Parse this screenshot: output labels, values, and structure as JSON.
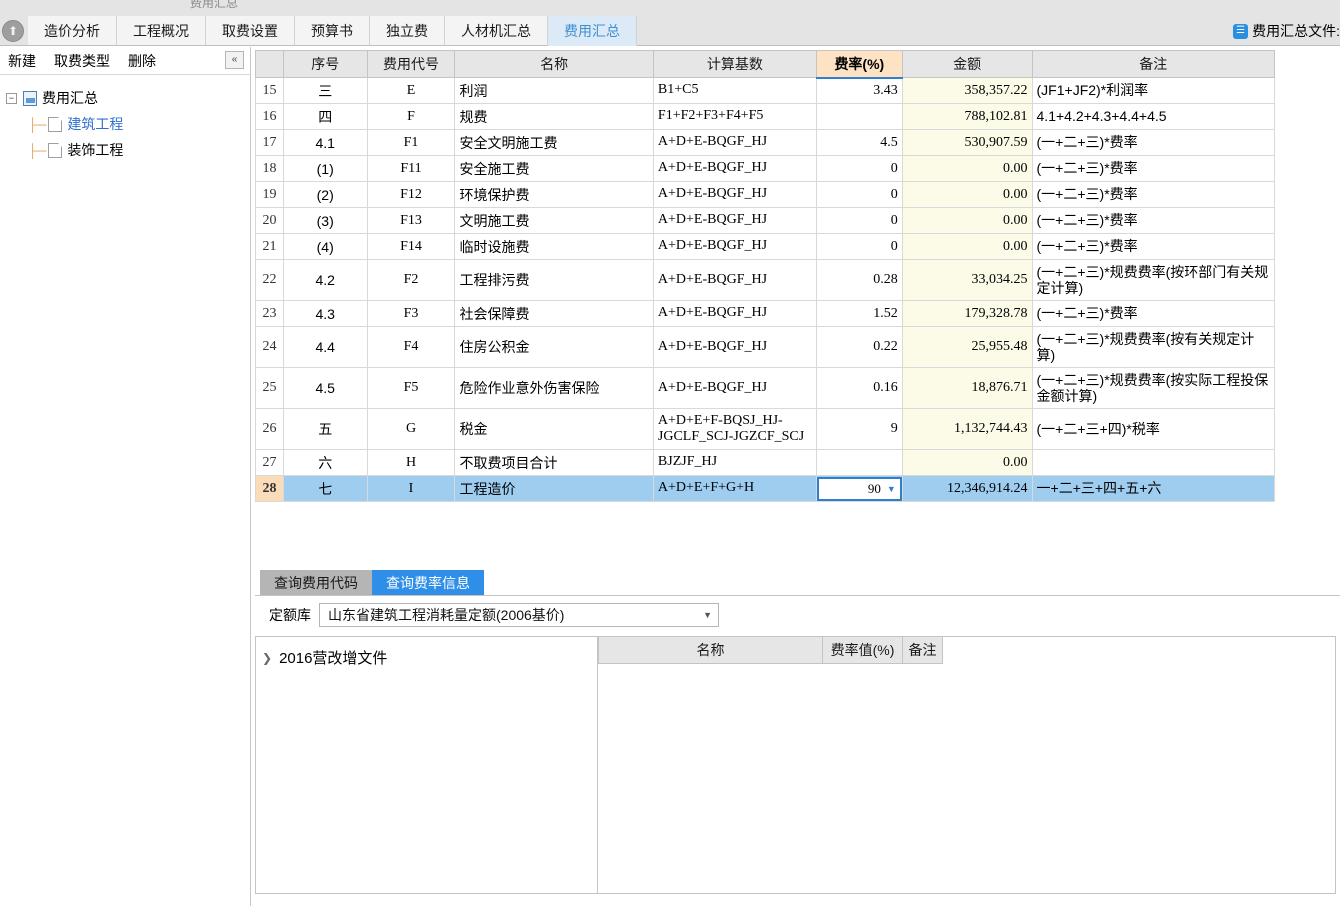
{
  "window": {
    "clipped_caption": "费用汇总"
  },
  "tabs": [
    {
      "label": "造价分析",
      "active": false
    },
    {
      "label": "工程概况",
      "active": false
    },
    {
      "label": "取费设置",
      "active": false
    },
    {
      "label": "预算书",
      "active": false
    },
    {
      "label": "独立费",
      "active": false
    },
    {
      "label": "人材机汇总",
      "active": false
    },
    {
      "label": "费用汇总",
      "active": true
    }
  ],
  "document_label": {
    "icon": "document-icon",
    "text": "费用汇总文件:"
  },
  "collapse_button": {
    "icon": "chevron-double-up-icon"
  },
  "left_panel": {
    "toolbar": [
      {
        "label": "新建"
      },
      {
        "label": "取费类型"
      },
      {
        "label": "删除"
      }
    ],
    "collapse_icon": "chevron-double-left-icon",
    "tree": [
      {
        "label": "费用汇总",
        "level": 1,
        "expander": "−",
        "icon": "chart-file-icon",
        "link": false
      },
      {
        "label": "建筑工程",
        "level": 2,
        "expander": "",
        "icon": "page-icon",
        "link": true
      },
      {
        "label": "装饰工程",
        "level": 2,
        "expander": "",
        "icon": "page-icon",
        "link": false
      }
    ]
  },
  "main_table": {
    "columns": [
      "",
      "序号",
      "费用代号",
      "名称",
      "计算基数",
      "费率(%)",
      "金额",
      "备注"
    ],
    "rate_column_highlight": "#fde3c4",
    "rows": [
      {
        "idx": "15",
        "no": "三",
        "code": "E",
        "name": "利润",
        "base": "B1+C5",
        "rate": "3.43",
        "amount": "358,357.22",
        "remark": "(JF1+JF2)*利润率",
        "tall": false,
        "selected": false
      },
      {
        "idx": "16",
        "no": "四",
        "code": "F",
        "name": "规费",
        "base": "F1+F2+F3+F4+F5",
        "rate": "",
        "amount": "788,102.81",
        "remark": "4.1+4.2+4.3+4.4+4.5",
        "tall": false,
        "selected": false
      },
      {
        "idx": "17",
        "no": "4.1",
        "code": "F1",
        "name": "安全文明施工费",
        "base": "A+D+E-BQGF_HJ",
        "rate": "4.5",
        "amount": "530,907.59",
        "remark": "(一+二+三)*费率",
        "tall": false,
        "selected": false
      },
      {
        "idx": "18",
        "no": "(1)",
        "code": "F11",
        "name": "安全施工费",
        "base": "A+D+E-BQGF_HJ",
        "rate": "0",
        "amount": "0.00",
        "remark": "(一+二+三)*费率",
        "tall": false,
        "selected": false
      },
      {
        "idx": "19",
        "no": "(2)",
        "code": "F12",
        "name": "环境保护费",
        "base": "A+D+E-BQGF_HJ",
        "rate": "0",
        "amount": "0.00",
        "remark": "(一+二+三)*费率",
        "tall": false,
        "selected": false
      },
      {
        "idx": "20",
        "no": "(3)",
        "code": "F13",
        "name": "文明施工费",
        "base": "A+D+E-BQGF_HJ",
        "rate": "0",
        "amount": "0.00",
        "remark": "(一+二+三)*费率",
        "tall": false,
        "selected": false
      },
      {
        "idx": "21",
        "no": "(4)",
        "code": "F14",
        "name": "临时设施费",
        "base": "A+D+E-BQGF_HJ",
        "rate": "0",
        "amount": "0.00",
        "remark": "(一+二+三)*费率",
        "tall": false,
        "selected": false
      },
      {
        "idx": "22",
        "no": "4.2",
        "code": "F2",
        "name": "工程排污费",
        "base": "A+D+E-BQGF_HJ",
        "rate": "0.28",
        "amount": "33,034.25",
        "remark": "(一+二+三)*规费费率(按环部门有关规定计算)",
        "tall": true,
        "selected": false
      },
      {
        "idx": "23",
        "no": "4.3",
        "code": "F3",
        "name": "社会保障费",
        "base": "A+D+E-BQGF_HJ",
        "rate": "1.52",
        "amount": "179,328.78",
        "remark": "(一+二+三)*费率",
        "tall": false,
        "selected": false
      },
      {
        "idx": "24",
        "no": "4.4",
        "code": "F4",
        "name": "住房公积金",
        "base": "A+D+E-BQGF_HJ",
        "rate": "0.22",
        "amount": "25,955.48",
        "remark": "(一+二+三)*规费费率(按有关规定计算)",
        "tall": true,
        "selected": false
      },
      {
        "idx": "25",
        "no": "4.5",
        "code": "F5",
        "name": "危险作业意外伤害保险",
        "base": "A+D+E-BQGF_HJ",
        "rate": "0.16",
        "amount": "18,876.71",
        "remark": "(一+二+三)*规费费率(按实际工程投保金额计算)",
        "tall": true,
        "selected": false
      },
      {
        "idx": "26",
        "no": "五",
        "code": "G",
        "name": "税金",
        "base": "A+D+E+F-BQSJ_HJ-JGCLF_SCJ-JGZCF_SCJ",
        "rate": "9",
        "amount": "1,132,744.43",
        "remark": "(一+二+三+四)*税率",
        "tall": true,
        "selected": false
      },
      {
        "idx": "27",
        "no": "六",
        "code": "H",
        "name": "不取费项目合计",
        "base": "BJZJF_HJ",
        "rate": "",
        "amount": "0.00",
        "remark": "",
        "tall": false,
        "selected": false
      },
      {
        "idx": "28",
        "no": "七",
        "code": "I",
        "name": "工程造价",
        "base": "A+D+E+F+G+H",
        "rate": "90",
        "amount": "12,346,914.24",
        "remark": "一+二+三+四+五+六",
        "tall": false,
        "selected": true
      }
    ]
  },
  "bottom_panel": {
    "tabs": [
      {
        "label": "查询费用代码",
        "active": false
      },
      {
        "label": "查询费率信息",
        "active": true
      }
    ],
    "filter": {
      "label": "定额库",
      "value": "山东省建筑工程消耗量定额(2006基价)",
      "caret": "chevron-down-icon"
    },
    "tree": [
      {
        "label": "2016营改增文件",
        "chev": "chevron-right-icon"
      }
    ],
    "table": {
      "columns": [
        "名称",
        "费率值(%)",
        "备注"
      ],
      "rows": []
    }
  }
}
